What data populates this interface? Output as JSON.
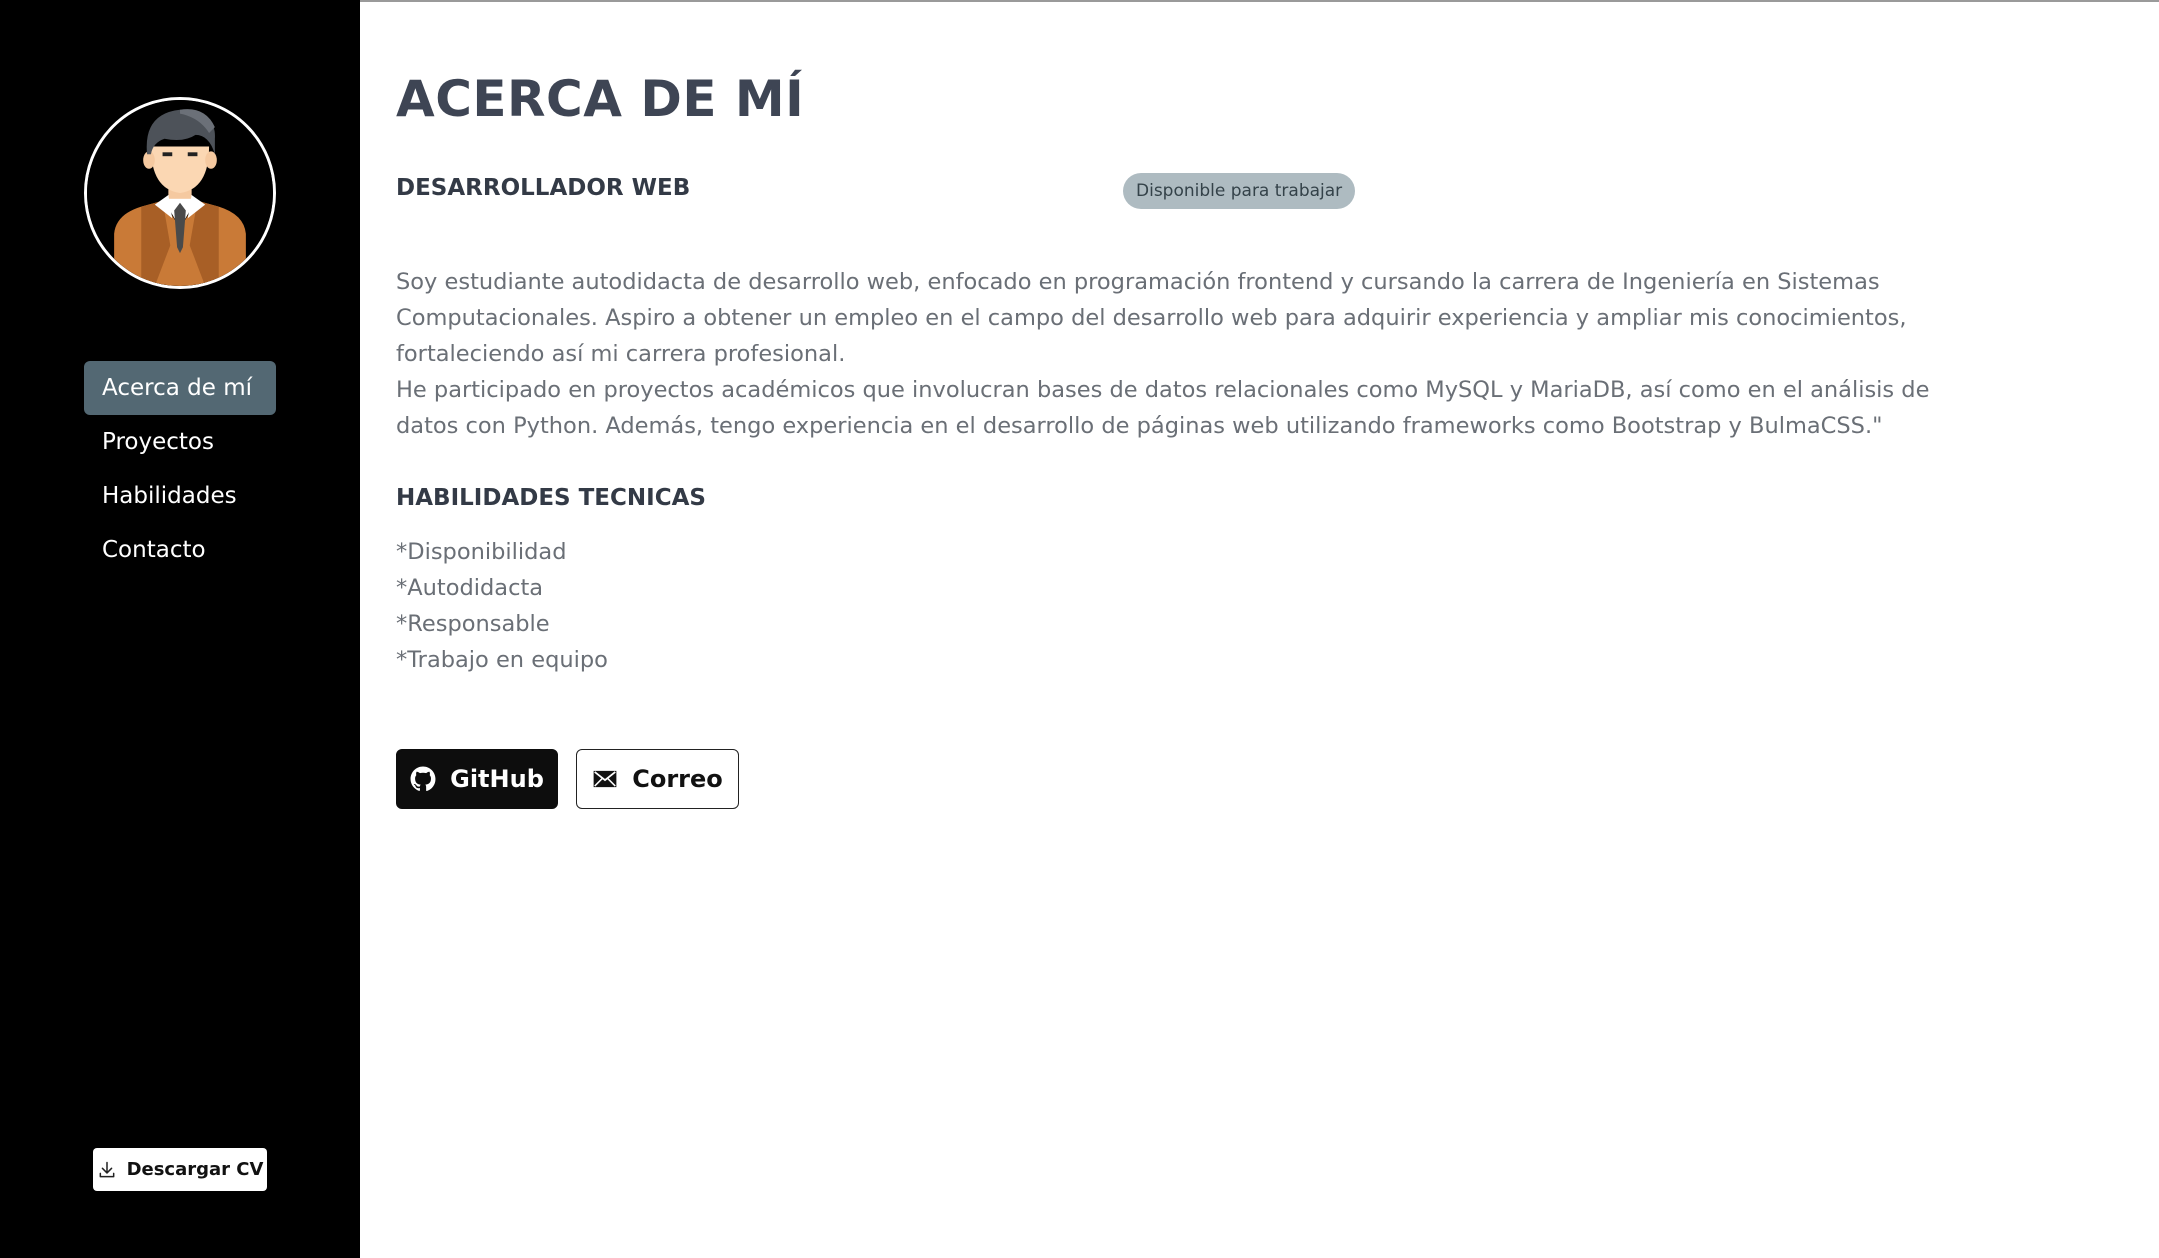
{
  "sidebar": {
    "nav": [
      {
        "label": "Acerca de mí",
        "active": true
      },
      {
        "label": "Proyectos",
        "active": false
      },
      {
        "label": "Habilidades",
        "active": false
      },
      {
        "label": "Contacto",
        "active": false
      }
    ],
    "download_cv_label": "Descargar CV",
    "download_icon": "download-icon"
  },
  "main": {
    "title": "ACERCA DE MÍ",
    "role": "DESARROLLADOR WEB",
    "availability_badge": "Disponible para trabajar",
    "bio_lines": [
      "Soy estudiante autodidacta de desarrollo web, enfocado en programación frontend y cursando la carrera de Ingeniería en Sistemas",
      "Computacionales. Aspiro a obtener un empleo en el campo del desarrollo web para adquirir experiencia y ampliar mis conocimientos,",
      "fortaleciendo así mi carrera profesional.",
      "He participado en proyectos académicos que involucran bases de datos relacionales como MySQL y MariaDB, así como en el análisis de",
      "datos con Python. Además, tengo experiencia en el desarrollo de páginas web utilizando frameworks como Bootstrap y BulmaCSS.\""
    ],
    "skills_title": "HABILIDADES TECNICAS",
    "skills": [
      "*Disponibilidad",
      "*Autodidacta",
      "*Responsable",
      "*Trabajo en equipo"
    ],
    "buttons": {
      "github_label": "GitHub",
      "github_icon": "github-icon",
      "mail_label": "Correo",
      "mail_icon": "envelope-icon"
    }
  },
  "colors": {
    "sidebar_bg": "#000000",
    "nav_active_bg": "#536873",
    "badge_bg": "#aebbc1",
    "heading": "#3e4554",
    "body_text": "#6a6f76"
  }
}
